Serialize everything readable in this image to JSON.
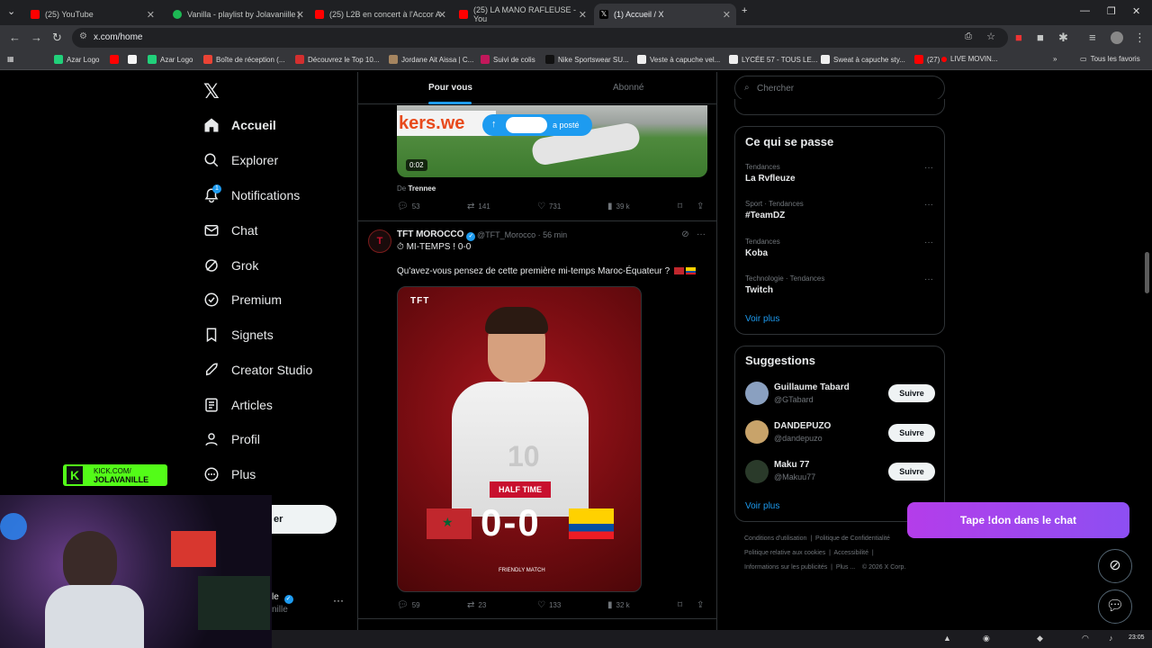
{
  "browser": {
    "tabs": [
      {
        "label": "(25) YouTube",
        "color": "#ff0000"
      },
      {
        "label": "Vanilla - playlist by Jolavaniille |",
        "color": "#1db954"
      },
      {
        "label": "(25) L2B en concert à l'Accor A",
        "color": "#ff0000"
      },
      {
        "label": "(25) LA MANO RAFLEUSE - You",
        "color": "#ff0000"
      },
      {
        "label": "(1) Accueil / X",
        "color": "#000000"
      }
    ],
    "url": "x.com/home",
    "bookmarks": [
      "Azar Logo",
      "",
      "",
      "Azar Logo",
      "Boîte de réception (...",
      "Découvrez le Top 10...",
      "Jordane Ait Aissa | C...",
      "Suivi de colis",
      "Nike Sportswear SU...",
      "Veste à capuche vel...",
      "LYCÉE 57 - TOUS LE...",
      "Sweat à capuche sty...",
      "(27)",
      "LIVE MOVIN..."
    ],
    "all_bookmarks": "Tous les favoris"
  },
  "nav": {
    "items": [
      {
        "label": "Accueil",
        "icon": "home-icon"
      },
      {
        "label": "Explorer",
        "icon": "search-icon"
      },
      {
        "label": "Notifications",
        "icon": "bell-icon"
      },
      {
        "label": "Chat",
        "icon": "mail-icon"
      },
      {
        "label": "Grok",
        "icon": "grok-icon"
      },
      {
        "label": "Premium",
        "icon": "verified-icon"
      },
      {
        "label": "Signets",
        "icon": "bookmark-icon"
      },
      {
        "label": "Creator Studio",
        "icon": "rocket-icon"
      },
      {
        "label": "Articles",
        "icon": "article-icon"
      },
      {
        "label": "Profil",
        "icon": "profile-icon"
      },
      {
        "label": "Plus",
        "icon": "more-icon"
      }
    ],
    "notification_count": "1",
    "post_button_fragment": "er",
    "account_fragment_name": "le",
    "account_fragment_handle": "nille"
  },
  "overlay": {
    "kick_line1": "KICK.COM/",
    "kick_line2": "JOLAVANILLE",
    "tape_banner": "Tape !don dans le chat"
  },
  "timeline": {
    "tabs": [
      "Pour vous",
      "Abonné"
    ],
    "posted_pill": "a posté",
    "post1": {
      "video_time": "0:02",
      "ad_text": "kers.we",
      "source_prefix": "De",
      "source": "Trennee",
      "replies": "53",
      "reposts": "141",
      "likes": "731",
      "views": "39 k"
    },
    "post2": {
      "name": "TFT MOROCCO",
      "handle": "@TFT_Morocco",
      "time": "· 56 min",
      "subline": "MI-TEMPS ! 0-0",
      "text": "Qu'avez-vous pensez de cette première mi-temps Maroc-Équateur ?",
      "media": {
        "brand": "TFT",
        "shirt_number": "10",
        "half_time": "HALF TIME",
        "score": "0-0",
        "match_type": "FRIENDLY MATCH"
      },
      "replies": "59",
      "reposts": "23",
      "likes": "133",
      "views": "32 k"
    }
  },
  "sidebar": {
    "search_placeholder": "Chercher",
    "trending_title": "Ce qui se passe",
    "trends": [
      {
        "category": "Tendances",
        "name": "La Rvfleuze"
      },
      {
        "category": "Sport · Tendances",
        "name": "#TeamDZ"
      },
      {
        "category": "Tendances",
        "name": "Koba"
      },
      {
        "category": "Technologie · Tendances",
        "name": "Twitch"
      }
    ],
    "see_more": "Voir plus",
    "suggestions_title": "Suggestions",
    "suggestions": [
      {
        "name": "Guillaume Tabard",
        "handle": "@GTabard",
        "button": "Suivre"
      },
      {
        "name": "DANDEPUZO",
        "handle": "@dandepuzo",
        "button": "Suivre"
      },
      {
        "name": "Maku 77",
        "handle": "@Makuu77",
        "button": "Suivre"
      }
    ],
    "suggestions_see_more": "Voir plus",
    "footer": [
      "Conditions d'utilisation",
      "Politique de Confidentialité",
      "Politique relative aux cookies",
      "Accessibilité",
      "Informations sur les publicités",
      "Plus ...",
      "© 2026 X Corp."
    ]
  },
  "system": {
    "clock": "23:05"
  }
}
